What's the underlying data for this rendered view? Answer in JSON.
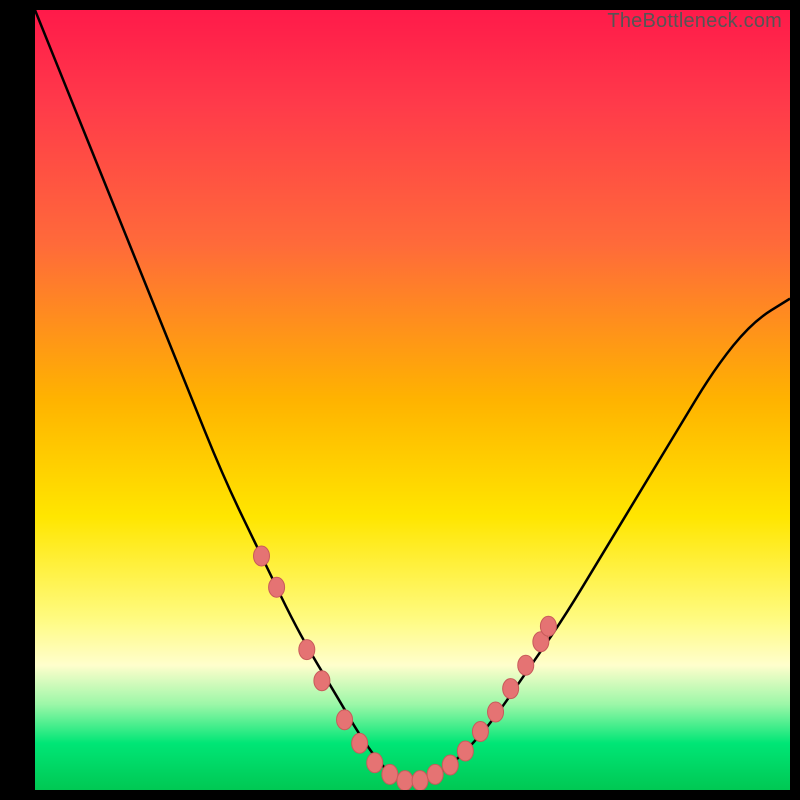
{
  "watermark": "TheBottleneck.com",
  "chart_data": {
    "type": "line",
    "title": "",
    "xlabel": "",
    "ylabel": "",
    "xlim": [
      0,
      100
    ],
    "ylim": [
      0,
      100
    ],
    "grid": false,
    "legend": false,
    "background_gradient": [
      "#ff1a4a",
      "#ffe600",
      "#00c853"
    ],
    "series": [
      {
        "name": "bottleneck-curve",
        "x": [
          0,
          5,
          10,
          15,
          20,
          25,
          30,
          35,
          40,
          43,
          46,
          48,
          50,
          52,
          55,
          60,
          65,
          70,
          75,
          80,
          85,
          90,
          95,
          100
        ],
        "y": [
          100,
          88,
          76,
          64,
          52,
          40,
          30,
          20,
          12,
          7,
          3,
          1.5,
          1,
          1.5,
          3,
          8,
          15,
          22,
          30,
          38,
          46,
          54,
          60,
          63
        ]
      }
    ],
    "markers": [
      {
        "x": 30,
        "y": 30
      },
      {
        "x": 32,
        "y": 26
      },
      {
        "x": 36,
        "y": 18
      },
      {
        "x": 38,
        "y": 14
      },
      {
        "x": 41,
        "y": 9
      },
      {
        "x": 43,
        "y": 6
      },
      {
        "x": 45,
        "y": 3.5
      },
      {
        "x": 47,
        "y": 2
      },
      {
        "x": 49,
        "y": 1.2
      },
      {
        "x": 51,
        "y": 1.2
      },
      {
        "x": 53,
        "y": 2
      },
      {
        "x": 55,
        "y": 3.2
      },
      {
        "x": 57,
        "y": 5
      },
      {
        "x": 59,
        "y": 7.5
      },
      {
        "x": 61,
        "y": 10
      },
      {
        "x": 63,
        "y": 13
      },
      {
        "x": 65,
        "y": 16
      },
      {
        "x": 67,
        "y": 19
      },
      {
        "x": 68,
        "y": 21
      }
    ]
  }
}
